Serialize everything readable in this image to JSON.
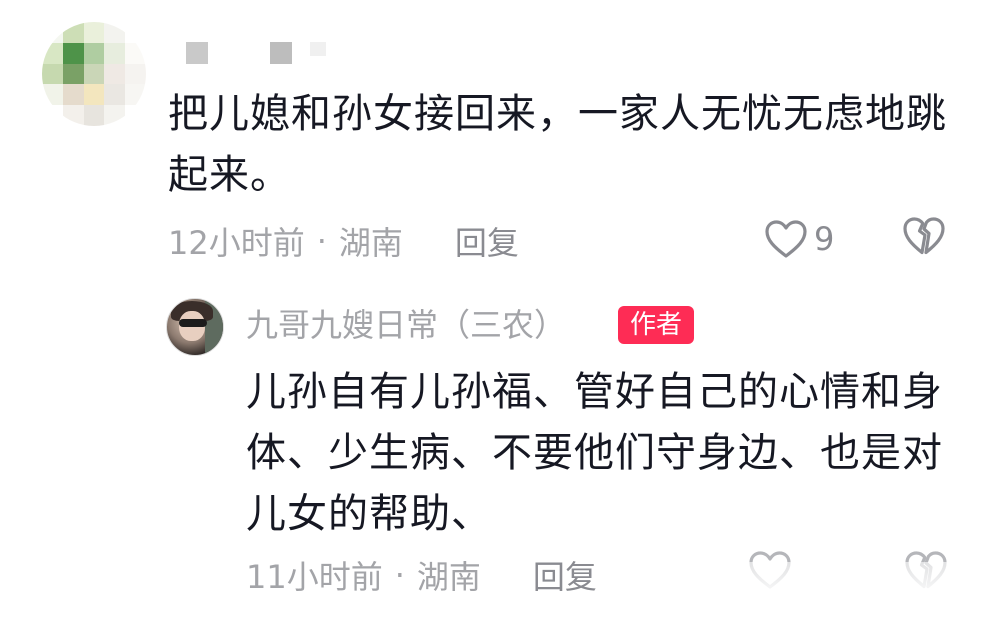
{
  "comment": {
    "text": "把儿媳和孙女接回来，一家人无忧无虑地跳起来。",
    "time": "12小时前",
    "separator": "·",
    "location": "湖南",
    "reply_label": "回复",
    "like_count": "9"
  },
  "reply": {
    "author": "九哥九嫂日常（三农）",
    "badge": "作者",
    "text": "儿孙自有儿孙福、管好自己的心情和身体、少生病、不要他们守身边、也是对儿女的帮助、",
    "time": "11小时前",
    "separator": "·",
    "location": "湖南",
    "reply_label": "回复"
  },
  "icons": {
    "like": "heart-outline-icon",
    "dislike": "broken-heart-icon"
  },
  "colors": {
    "text": "#161823",
    "meta": "#a3a4a8",
    "badge": "#fe2c55"
  }
}
